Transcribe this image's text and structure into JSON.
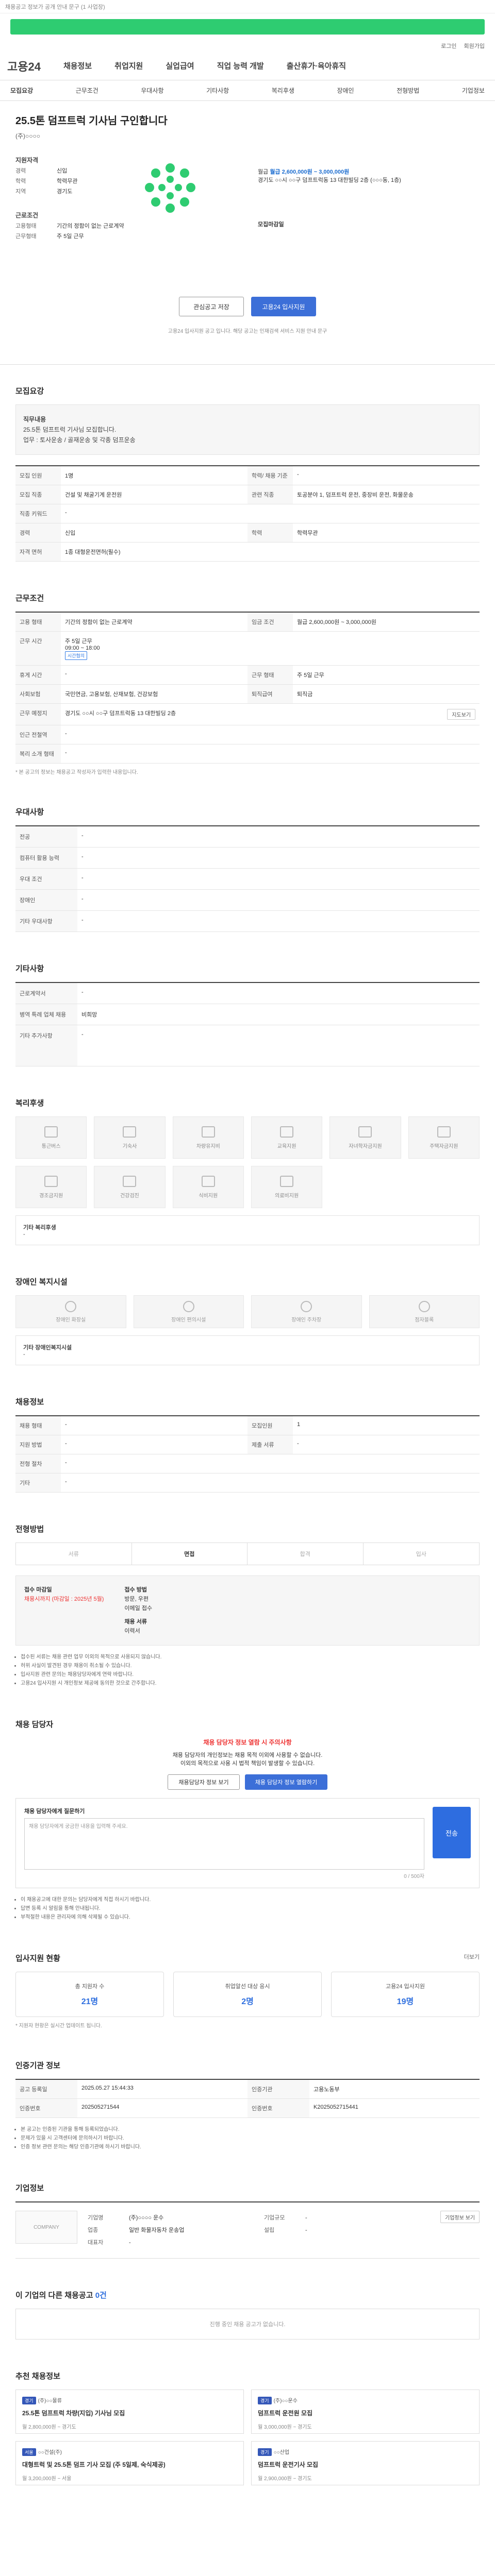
{
  "top": {
    "notice": "채용공고 정보가 공개 안내 문구 (1 사업장)"
  },
  "util": {
    "a": "로그인",
    "b": "회원가입"
  },
  "gnb": {
    "logo": "고용24",
    "menus": [
      "채용정보",
      "취업지원",
      "실업급여",
      "직업 능력 개발",
      "출산휴가·육아휴직"
    ]
  },
  "tabs": [
    "모집요강",
    "근무조건",
    "우대사항",
    "기타사항",
    "복리후생",
    "장애인",
    "전형방법",
    "기업정보"
  ],
  "hero": {
    "title": "25.5톤 덤프트럭 기사님 구인합니다",
    "company": "(주)○○○○",
    "sec1": "지원자격",
    "k1": "경력",
    "v1": "신입",
    "k2": "학력",
    "v2": "학력무관",
    "k3": "지역",
    "v3": "경기도",
    "sec2": "근로조건",
    "k4": "고용형태",
    "v4": "기간의 정함이 없는 근로계약",
    "k5": "근무형태",
    "v5": "주 5일 근무",
    "sec3": "채용조건",
    "salary_label": "월급",
    "salary": "월급 2,600,000원 ~ 3,000,000원",
    "addr": "경기도 ○○시 ○○구 덤프트럭동 13 대한빌딩 2층 (○○○동, 1층)",
    "deadline": "모집마감일",
    "btn_scrap": "관심공고 저장",
    "btn_apply": "고용24 입사지원",
    "note": "고용24 입사지원 공고 입니다. 해당 공고는 인재검색 서비스 지원 안내 문구"
  },
  "recruit": {
    "title": "모집요강",
    "job_title": "직무내용",
    "job_desc": "25.5톤 덤프트럭 기사님 모집합니다.",
    "work": "업무 : 토사운송 / 골재운송 및 각종 덤프운송",
    "rows": [
      [
        "모집 인원",
        "1명",
        "학력/ 채용 기준",
        "-"
      ],
      [
        "모집 직종",
        "건설 및 채굴기계 운전원",
        "관련 직종",
        "토공분야 1, 덤프트럭 운전, 중장비 운전, 화물운송"
      ],
      [
        "직종 키워드",
        "-",
        "",
        ""
      ],
      [
        "경력",
        "신입",
        "학력",
        "학력무관"
      ],
      [
        "자격 면허",
        "1종 대형운전면허(필수)",
        "",
        ""
      ]
    ]
  },
  "cond": {
    "title": "근무조건",
    "rows": [
      [
        "고용 형태",
        "기간의 정함이 없는 근로계약",
        "임금 조건",
        "월급 2,600,000원 ~ 3,000,000원"
      ],
      [
        "근무 시간",
        "주 5일 근무",
        "",
        ""
      ],
      [
        "휴게 시간",
        "-",
        "근무 형태",
        "주 5일 근무"
      ],
      [
        "사회보험",
        "국민연금, 고용보험, 산재보험, 건강보험",
        "퇴직급여",
        "퇴직금"
      ],
      [
        "근무 예정지",
        "경기도 ○○시 ○○구 덤프트럭동 13 대한빌딩 2층",
        "",
        ""
      ],
      [
        "인근 전철역",
        "-",
        "",
        ""
      ],
      [
        "복리 소개 형태",
        "-",
        "",
        ""
      ]
    ],
    "hours": "09:00 ~ 18:00",
    "badge": "시간협의",
    "btn_map": "지도보기",
    "foot": "* 본 공고의 정보는 채용공고 작성자가 입력한 내용입니다."
  },
  "pref": {
    "title": "우대사항",
    "rows": [
      [
        "전공",
        "-"
      ],
      [
        "컴퓨터 활용 능력",
        "-"
      ],
      [
        "우대 조건",
        "-"
      ],
      [
        "장애인",
        "-"
      ],
      [
        "기타 우대사항",
        "-"
      ]
    ]
  },
  "etc": {
    "title": "기타사항",
    "rows": [
      [
        "근로계약서",
        "-"
      ],
      [
        "병역 특례 업체 채용",
        "비희망"
      ],
      [
        "기타 추가사항",
        "-"
      ]
    ]
  },
  "welfare": {
    "title": "복리후생",
    "cards": [
      "통근버스",
      "기숙사",
      "차량유지비",
      "교육지원",
      "자녀학자금지원",
      "주택자금지원",
      "경조금지원",
      "건강검진",
      "식비지원",
      "의료비지원"
    ],
    "box_title": "기타 복리후생",
    "box_val": "-"
  },
  "disab": {
    "title": "장애인 복지시설",
    "cards": [
      "장애인 화장실",
      "장애인 편의시설",
      "장애인 주차장",
      "점자블록"
    ],
    "box_title": "기타 장애인복지시설",
    "box_val": "-"
  },
  "cert": {
    "title": "채용정보",
    "rows": [
      [
        "채용 형태",
        "-",
        "모집인원",
        "1"
      ],
      [
        "지원 방법",
        "-",
        "제출 서류",
        "-"
      ],
      [
        "전형 절차",
        "-",
        "",
        ""
      ],
      [
        "기타",
        "-",
        "",
        ""
      ]
    ]
  },
  "process": {
    "title": "전형방법",
    "steps": [
      "서류",
      "면접",
      "합격",
      "입사"
    ],
    "apply_lab": "접수 마감일",
    "apply_red": "채용시까지 (마감일 : 2025년 5월)",
    "apply_how": "접수 방법",
    "apply_v1": "방문, 우편",
    "apply_v2": "이메일 접수",
    "apply_v3": "채용 서류",
    "apply_v4": "이력서",
    "notes": [
      "접수된 서류는 채용 관련 업무 이외의 목적으로 사용되지 않습니다.",
      "허위 사실이 발견된 경우 채용이 취소될 수 있습니다.",
      "입사지원 관련 문의는 채용담당자에게 연락 바랍니다.",
      "고용24 입사지원 시 개인정보 제공에 동의한 것으로 간주합니다."
    ]
  },
  "contact": {
    "title": "채용 담당자",
    "alert": "채용 담당자 정보 열람 시 주의사항",
    "desc1": "채용 담당자의 개인정보는 채용 목적 이외에 사용할 수 없습니다.",
    "desc2": "이외의 목적으로 사용 시 법적 책임이 발생할 수 있습니다.",
    "btn_view": "채용담당자 정보 보기",
    "btn_notify": "채용 담당자 정보 열람하기",
    "report_label": "채용 담당자에게 질문하기",
    "report_ph": "채용 담당자에게 궁금한 내용을 입력해 주세요.",
    "btn_send": "전송",
    "counter": "0 / 500자",
    "notes": [
      "이 채용공고에 대한 문의는 담당자에게 직접 하시기 바랍니다.",
      "답변 등록 시 알림을 통해 안내됩니다.",
      "부적절한 내용은 관리자에 의해 삭제될 수 있습니다."
    ]
  },
  "status": {
    "title": "입사지원 현황",
    "more": "더보기",
    "stats": [
      [
        "총 지원자 수",
        "21명"
      ],
      [
        "취업알선 대상 응시",
        "2명"
      ],
      [
        "고용24 입사지원",
        "19명"
      ]
    ],
    "note": "* 지원자 현황은 실시간 업데이트 됩니다."
  },
  "certinfo": {
    "title": "인증기관 정보",
    "rows": [
      [
        "공고 등록일",
        "2025.05.27 15:44:33",
        "인증기관",
        "고용노동부"
      ],
      [
        "인증번호",
        "202505271544",
        "인증번호",
        "K2025052715441"
      ]
    ],
    "notes": [
      "본 공고는 인증된 기관을 통해 등록되었습니다.",
      "문제가 있을 시 고객센터에 문의하시기 바랍니다.",
      "인증 정보 관련 문의는 해당 인증기관에 하시기 바랍니다."
    ]
  },
  "company": {
    "title": "기업정보",
    "logo_ph": "COMPANY",
    "k1": "기업명",
    "v1": "(주)○○○○ 운수",
    "k2": "업종",
    "v2": "일반 화물자동차 운송업",
    "k3": "대표자",
    "v3": "-",
    "k4": "기업규모",
    "v4": "-",
    "k5": "설립",
    "v5": "-",
    "btn": "기업정보 보기"
  },
  "other": {
    "title": "이 기업의 다른 채용공고",
    "count": "0건",
    "empty": "진행 중인 채용 공고가 없습니다."
  },
  "recs": {
    "title": "추천 채용정보",
    "items": [
      {
        "tag": "경기",
        "co": "(주)○○물류",
        "title": "25.5톤 덤프트럭 차량(지입) 기사님 모집",
        "meta": "월 2,800,000원 ~ 경기도"
      },
      {
        "tag": "경기",
        "co": "(주)○○운수",
        "title": "덤프트럭 운전원 모집",
        "meta": "월 3,000,000원 ~ 경기도"
      },
      {
        "tag": "서울",
        "co": "○○건설(주)",
        "title": "대형트럭 및 25.5톤 덤프 기사 모집 (주 5일제, 숙식제공)",
        "meta": "월 3,200,000원 ~ 서울"
      },
      {
        "tag": "경기",
        "co": "○○산업",
        "title": "덤프트럭 운전기사 모집",
        "meta": "월 2,900,000원 ~ 경기도"
      }
    ]
  }
}
